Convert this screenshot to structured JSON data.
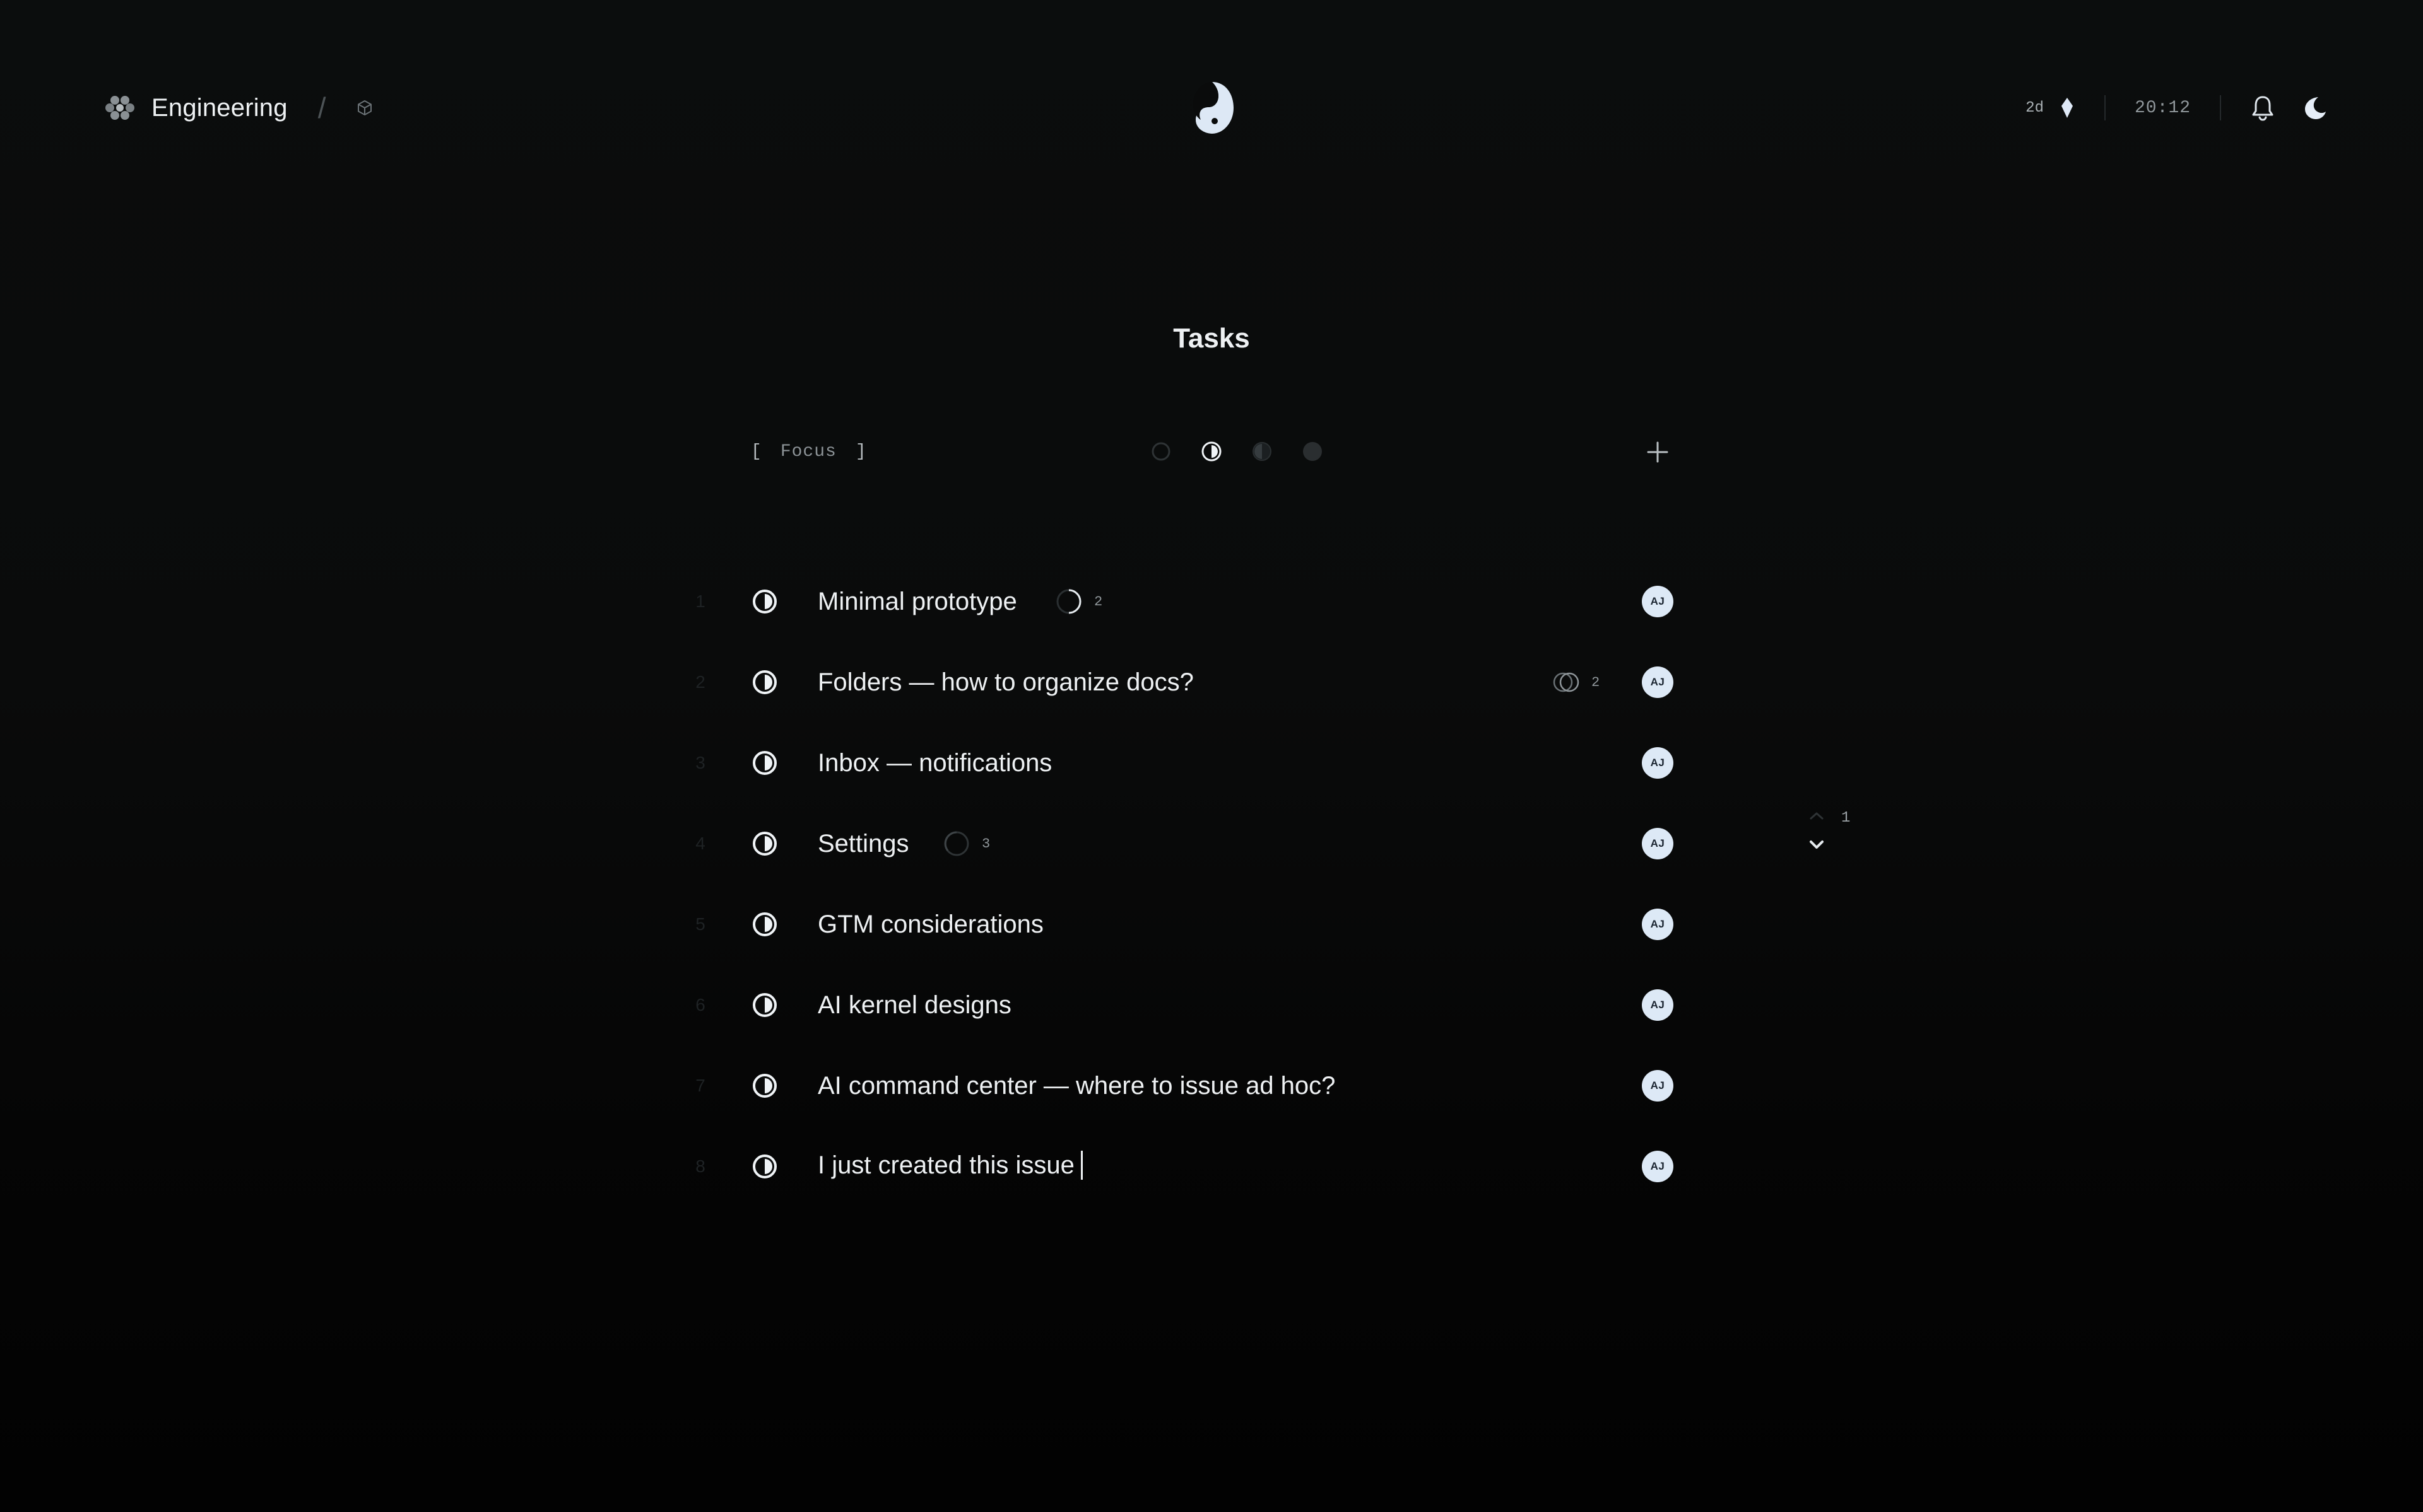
{
  "header": {
    "workspace_name": "Engineering",
    "separator": "/",
    "age": "2d",
    "time": "20:12"
  },
  "page_title": "Tasks",
  "toolbar": {
    "focus_open": "[",
    "focus_label": "Focus",
    "focus_close": "]",
    "filters": [
      "backlog",
      "in-progress",
      "review",
      "done"
    ],
    "add_icon": "plus-icon"
  },
  "tasks": [
    {
      "num": "1",
      "title": "Minimal prototype",
      "assignee": "AJ",
      "meta": {
        "icon": "half-progress-icon",
        "count": "2"
      }
    },
    {
      "num": "2",
      "title": "Folders — how to organize docs?",
      "assignee": "AJ",
      "meta": {
        "icon": "linked-circles-icon",
        "count": "2"
      }
    },
    {
      "num": "3",
      "title": "Inbox — notifications",
      "assignee": "AJ"
    },
    {
      "num": "4",
      "title": "Settings",
      "assignee": "AJ",
      "meta": {
        "icon": "empty-progress-icon",
        "count": "3"
      }
    },
    {
      "num": "5",
      "title": "GTM considerations",
      "assignee": "AJ"
    },
    {
      "num": "6",
      "title": "AI kernel designs",
      "assignee": "AJ"
    },
    {
      "num": "7",
      "title": "AI command center — where to issue ad hoc?",
      "assignee": "AJ"
    },
    {
      "num": "8",
      "title": "I just created this issue",
      "assignee": "AJ",
      "editing": true
    }
  ],
  "pager": {
    "page": "1"
  },
  "colors": {
    "background": "#0a0b0b",
    "text": "#eef1f3",
    "muted": "#8f969a",
    "avatar_bg": "#dde9f6",
    "accent": "#dfe9f7"
  }
}
